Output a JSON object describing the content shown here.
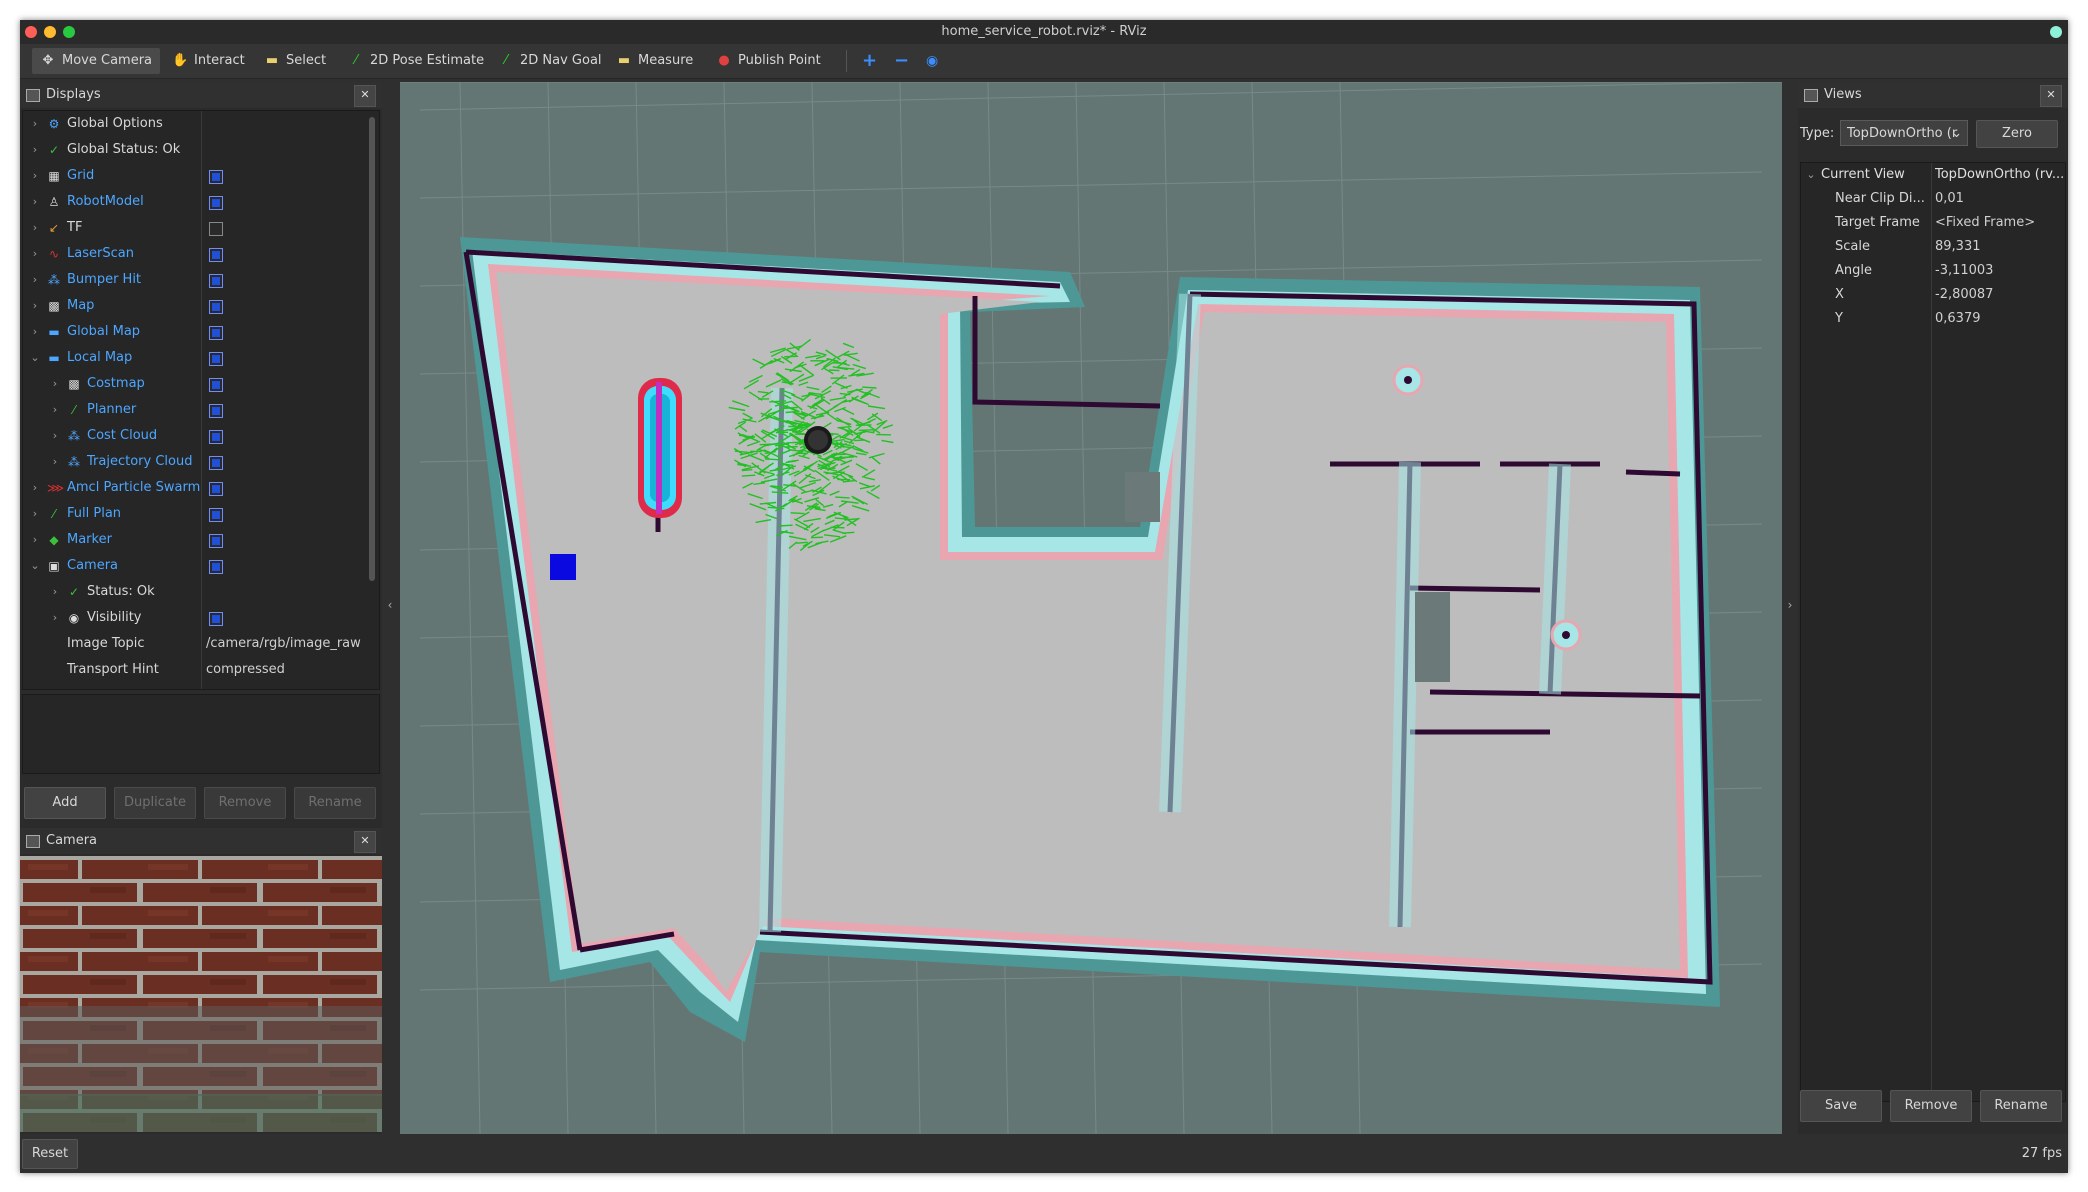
{
  "window": {
    "title": "home_service_robot.rviz* - RViz"
  },
  "colors": {
    "bg": "#2f2f2f",
    "accent_blue": "#4da6ff",
    "grid_bg": "#647674",
    "green": "#22c022"
  },
  "toolbar": {
    "tools": [
      {
        "label": "Move Camera",
        "icon": "move-camera-icon"
      },
      {
        "label": "Interact",
        "icon": "interact-hand-icon"
      },
      {
        "label": "Select",
        "icon": "select-icon"
      },
      {
        "label": "2D Pose Estimate",
        "icon": "pose-estimate-icon"
      },
      {
        "label": "2D Nav Goal",
        "icon": "nav-goal-icon"
      },
      {
        "label": "Measure",
        "icon": "measure-icon"
      },
      {
        "label": "Publish Point",
        "icon": "publish-point-icon"
      }
    ]
  },
  "displays": {
    "title": "Displays",
    "items": [
      {
        "label": "Global Options",
        "type": "gear-icon"
      },
      {
        "label": "Global Status: Ok",
        "type": "check-icon"
      },
      {
        "label": "Grid",
        "checked": true
      },
      {
        "label": "RobotModel",
        "checked": true
      },
      {
        "label": "TF",
        "checked": false
      },
      {
        "label": "LaserScan",
        "checked": true
      },
      {
        "label": "Bumper Hit",
        "checked": true
      },
      {
        "label": "Map",
        "checked": true
      },
      {
        "label": "Global Map",
        "checked": true
      },
      {
        "label": "Local Map",
        "checked": true
      },
      {
        "label": "Costmap",
        "checked": true
      },
      {
        "label": "Planner",
        "checked": true
      },
      {
        "label": "Cost Cloud",
        "checked": true
      },
      {
        "label": "Trajectory Cloud",
        "checked": true
      },
      {
        "label": "Amcl Particle Swarm",
        "checked": true
      },
      {
        "label": "Full Plan",
        "checked": true
      },
      {
        "label": "Marker",
        "checked": true
      },
      {
        "label": "Camera",
        "checked": true
      },
      {
        "label": "Status: Ok"
      },
      {
        "label": "Visibility",
        "checked": true
      },
      {
        "label": "Image Topic",
        "value": "/camera/rgb/image_raw"
      },
      {
        "label": "Transport Hint",
        "value": "compressed"
      }
    ],
    "buttons": {
      "add": "Add",
      "duplicate": "Duplicate",
      "remove": "Remove",
      "rename": "Rename"
    }
  },
  "camera": {
    "title": "Camera"
  },
  "views": {
    "title": "Views",
    "type_label": "Type:",
    "type_value": "TopDownOrtho (r",
    "zero": "Zero",
    "current_view": "Current View",
    "current_view_value": "TopDownOrtho (rv...",
    "props": [
      {
        "name": "Near Clip Di...",
        "value": "0,01"
      },
      {
        "name": "Target Frame",
        "value": "<Fixed Frame>"
      },
      {
        "name": "Scale",
        "value": "89,331"
      },
      {
        "name": "Angle",
        "value": "-3,11003"
      },
      {
        "name": "X",
        "value": "-2,80087"
      },
      {
        "name": "Y",
        "value": "0,6379"
      }
    ],
    "buttons": {
      "save": "Save",
      "remove": "Remove",
      "rename": "Rename"
    }
  },
  "status": {
    "reset": "Reset",
    "fps": "27 fps"
  }
}
